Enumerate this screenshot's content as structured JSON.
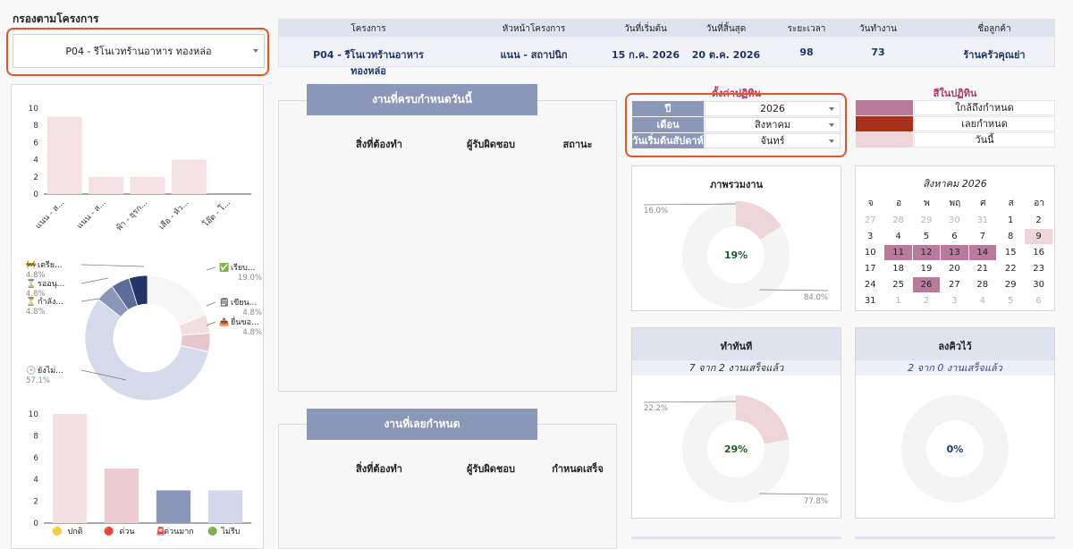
{
  "filter": {
    "title": "กรองตามโครงการ",
    "project_value": "P04 - รีโนเวทร้านอาหาร ทองหล่อ"
  },
  "project_table": {
    "headers": [
      "โครงการ",
      "หัวหน้าโครงการ",
      "วันที่เริ่มต้น",
      "วันที่สิ้นสุด",
      "ระยะเวลา",
      "วันทำงาน",
      "ชื่อลูกค้า"
    ],
    "row": [
      "P04 - รีโนเวทร้านอาหาร ทองหล่อ",
      "แนน - สถาปนิก",
      "15 ก.ค. 2026",
      "20 ต.ค. 2026",
      "98",
      "73",
      "ร้านครัวคุณย่า"
    ]
  },
  "due_today": {
    "title": "งานที่ครบกำหนดวันนี้",
    "headers": [
      "สิ่งที่ต้องทำ",
      "ผู้รับผิดชอบ",
      "สถานะ"
    ]
  },
  "overdue": {
    "title": "งานที่เลยกำหนด",
    "headers": [
      "สิ่งที่ต้องทำ",
      "ผู้รับผิดชอบ",
      "กำหนดเสร็จ"
    ]
  },
  "calendar_settings": {
    "title": "ตั้งค่าปฏิทิน",
    "rows": [
      {
        "label": "ปี",
        "value": "2026"
      },
      {
        "label": "เดือน",
        "value": "สิงหาคม"
      },
      {
        "label": "วันเริ่มต้นสัปดาห์",
        "value": "จันทร์"
      }
    ]
  },
  "calendar_colors": {
    "title": "สีในปฏิทิน",
    "items": [
      {
        "label": "ใกล้ถึงกำหนด",
        "color": "#b97b9b"
      },
      {
        "label": "เลยกำหนด",
        "color": "#a7301a"
      },
      {
        "label": "วันนี้",
        "color": "#efd4da"
      }
    ]
  },
  "calendar": {
    "title": "สิงหาคม 2026",
    "weekdays": [
      "จ",
      "อ",
      "พ",
      "พฤ",
      "ศ",
      "ส",
      "อา"
    ],
    "weeks": [
      [
        "27",
        "28",
        "29",
        "30",
        "31",
        "1",
        "2"
      ],
      [
        "3",
        "4",
        "5",
        "6",
        "7",
        "8",
        "9"
      ],
      [
        "10",
        "11",
        "12",
        "13",
        "14",
        "15",
        "16"
      ],
      [
        "17",
        "18",
        "19",
        "20",
        "21",
        "22",
        "23"
      ],
      [
        "24",
        "25",
        "26",
        "27",
        "28",
        "29",
        "30"
      ],
      [
        "31",
        "1",
        "2",
        "3",
        "4",
        "5",
        "6"
      ]
    ],
    "muted_cells": [
      "0-0",
      "0-1",
      "0-2",
      "0-3",
      "0-4",
      "5-1",
      "5-2",
      "5-3",
      "5-4",
      "5-5",
      "5-6"
    ],
    "near_due_cells": [
      "2-1",
      "2-2",
      "2-3",
      "2-4",
      "4-2"
    ],
    "today_cells": [
      "1-6"
    ]
  },
  "overview": {
    "title": "ภาพรวมงาน",
    "percent_label": "19%",
    "done_pct": "16.0%",
    "remaining_pct": "84.0%"
  },
  "do_now": {
    "title": "ทำทันที",
    "subtitle": "7 จาก 2 งานเสร็จแล้ว",
    "percent_label": "29%",
    "done_pct": "22.2%",
    "remaining_pct": "77.8%"
  },
  "schedule": {
    "title": "ลงคิวไว้",
    "subtitle": "2 จาก 0 งานเสร็จแล้ว",
    "percent_label": "0%"
  },
  "chart_data": [
    {
      "type": "bar",
      "categories": [
        "แนน - ส...",
        "แนน - ส...",
        "ฟ้า - ธุรก...",
        "เสือ - หัว...",
        "โอ๊ต - โ..."
      ],
      "values": [
        9,
        2,
        2,
        4,
        0
      ],
      "ylim": [
        0,
        10
      ],
      "yticks": [
        "0",
        "2",
        "4",
        "6",
        "8",
        "10"
      ]
    },
    {
      "type": "pie",
      "slices": [
        {
          "label": "เรียบ...",
          "icon": "✅",
          "pct": "19.0%",
          "value": 19.0,
          "color": "#f6f6f6"
        },
        {
          "label": "เขียน...",
          "icon": "🗒",
          "pct": "4.8%",
          "value": 4.8,
          "color": "#f2dfe2"
        },
        {
          "label": "ยื่นขอ...",
          "icon": "📤",
          "pct": "4.8%",
          "value": 4.8,
          "color": "#e9c6ce"
        },
        {
          "label": "ยังไม่...",
          "icon": "🕒",
          "pct": "57.1%",
          "value": 57.1,
          "color": "#d5dbeb"
        },
        {
          "label": "กำลัง...",
          "icon": "⏳",
          "pct": "4.8%",
          "value": 4.8,
          "color": "#8a97b8"
        },
        {
          "label": "รออนุ...",
          "icon": "⌛",
          "pct": "4.8%",
          "value": 4.8,
          "color": "#5c6d99"
        },
        {
          "label": "เตรีย...",
          "icon": "🚧",
          "pct": "4.8%",
          "value": 4.8,
          "color": "#253466"
        }
      ]
    },
    {
      "type": "bar",
      "categories": [
        "ปกติ",
        "ด่วน",
        "ด่วนมาก",
        "ไม่รีบ"
      ],
      "legend_icons": [
        "🟡",
        "🔴",
        "🚨",
        "🟢"
      ],
      "values": [
        10,
        5,
        3,
        3
      ],
      "colors": [
        "#f4e1e4",
        "#eccbd2",
        "#8a97b8",
        "#d3d9ea"
      ],
      "ylim": [
        0,
        10
      ],
      "yticks": [
        "0",
        "2",
        "4",
        "6",
        "8",
        "10"
      ]
    },
    {
      "type": "pie",
      "name_ref": "overview",
      "values": [
        16.0,
        84.0
      ]
    },
    {
      "type": "pie",
      "name_ref": "do_now",
      "values": [
        22.2,
        77.8
      ]
    },
    {
      "type": "pie",
      "name_ref": "schedule",
      "values": [
        0,
        100
      ]
    }
  ]
}
